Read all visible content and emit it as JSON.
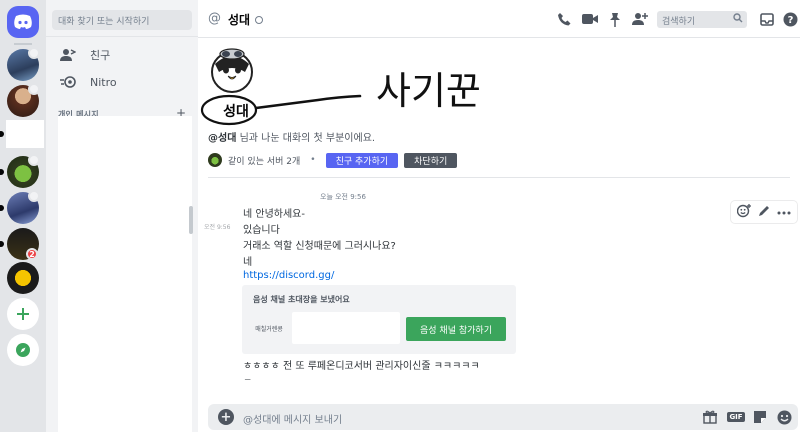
{
  "sidebar": {
    "search_placeholder": "대화 찾기 또는 시작하기",
    "items": [
      {
        "label": "친구",
        "icon": "friends-icon"
      },
      {
        "label": "Nitro",
        "icon": "nitro-icon"
      }
    ],
    "dm_header": "개인 메시지",
    "server_badge": "2"
  },
  "header": {
    "channel_name": "성대",
    "search_placeholder": "검색하기"
  },
  "welcome": {
    "name": "성대",
    "text_name": "@성대",
    "text_rest": " 님과 나눈 대화의 첫 부분이에요.",
    "mutual_servers": "같이 있는 서버 2개",
    "add_friend_button": "친구 추가하기",
    "block_button": "차단하기",
    "handwriting": "사기꾼"
  },
  "messages": {
    "date_label": "오늘 오전 9:56",
    "time_label": "오전 9:56",
    "lines": [
      "네 안녕하세요-",
      "있습니다",
      "거래소 역할 신청때문에 그러시나요?",
      "네",
      "https://discord.gg/",
      "ㅎㅎㅎㅎ 전 또 루페온디코서버 관리자이신줄 ㅋㅋㅋㅋㅋ"
    ],
    "invite": {
      "title": "음성 채널 초대장을 보냈어요",
      "server_name": "매칠거렌콩",
      "join_button": "음성 채널 참가하기"
    }
  },
  "composer": {
    "placeholder": "@성대에 메시지 보내기",
    "gif_label": "GIF"
  },
  "colors": {
    "blurple": "#5865f2",
    "green": "#3ba55c",
    "link": "#0068e0",
    "sidebar_bg": "#f2f3f5",
    "rail_bg": "#e3e5e8"
  }
}
